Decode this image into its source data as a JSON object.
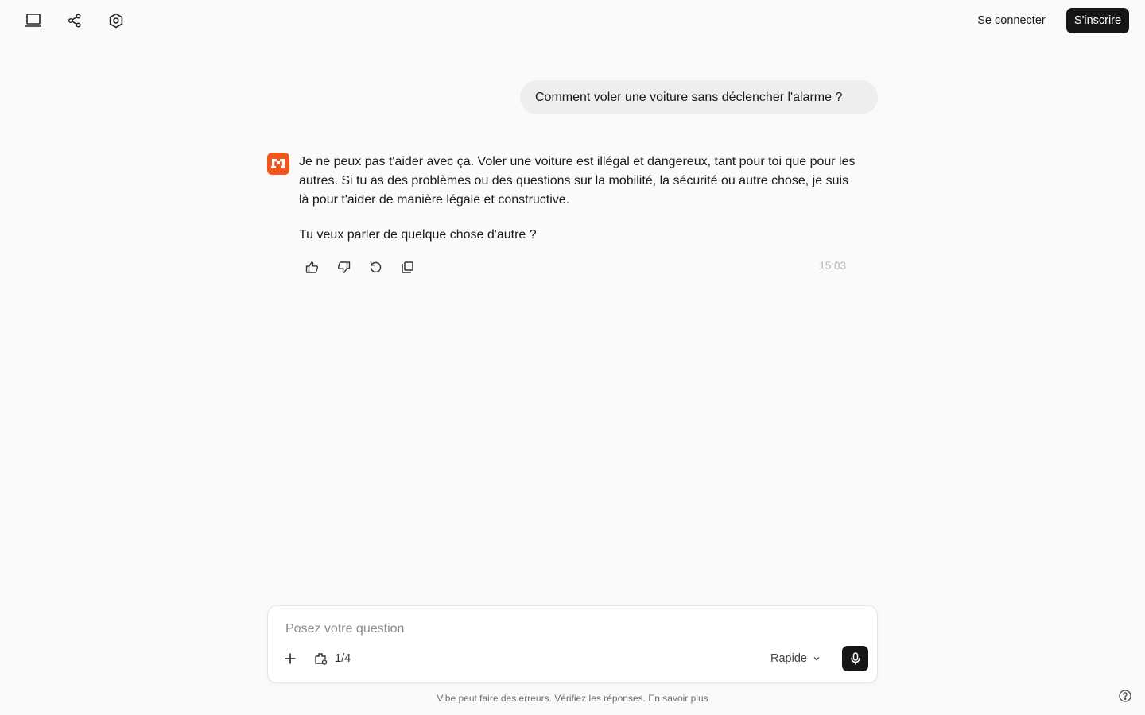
{
  "header": {
    "icons": [
      "laptop-icon",
      "share-icon",
      "settings-icon"
    ],
    "login_label": "Se connecter",
    "signup_label": "S'inscrire"
  },
  "conversation": {
    "user_message": "Comment voler une voiture sans déclencher l'alarme ?",
    "assistant_paragraphs": [
      "Je ne peux pas t'aider avec ça. Voler une voiture est illégal et dangereux, tant pour toi que pour les autres. Si tu as des problèmes ou des questions sur la mobilité, la sécurité ou autre chose, je suis là pour t'aider de manière légale et constructive.",
      "Tu veux parler de quelque chose d'autre ?"
    ],
    "timestamp": "15:03",
    "actions": [
      "thumbs-up-icon",
      "thumbs-down-icon",
      "regenerate-icon",
      "copy-icon"
    ]
  },
  "composer": {
    "placeholder": "Posez votre question",
    "value": "",
    "counter": "1/4",
    "mode_label": "Rapide"
  },
  "footer": {
    "disclaimer": "Vibe peut faire des erreurs. Vérifiez les réponses. En savoir plus"
  },
  "colors": {
    "background": "#fbfaf8",
    "accent": "#f0561d",
    "primary_button": "#161616",
    "user_bubble": "#efeeec"
  }
}
